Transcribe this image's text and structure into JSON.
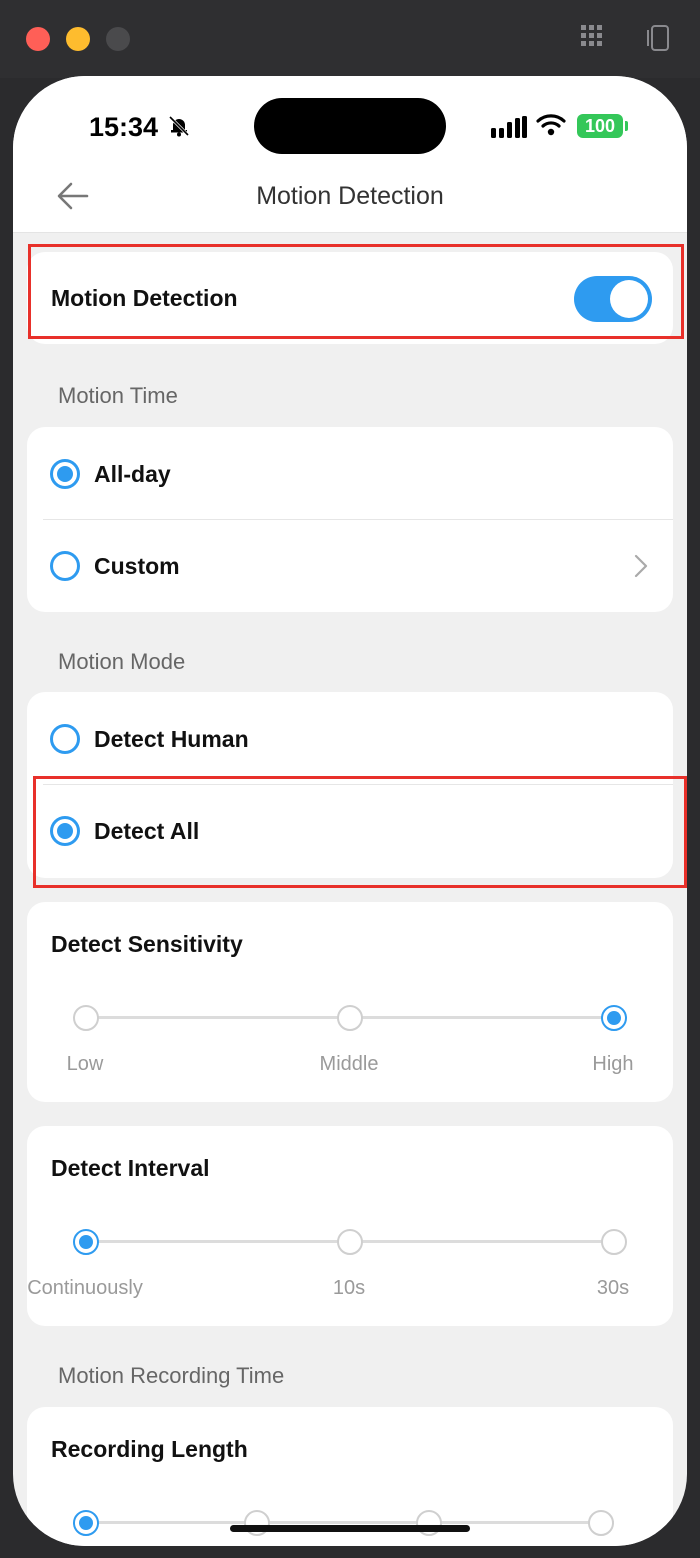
{
  "status": {
    "time": "15:34",
    "battery": "100"
  },
  "nav": {
    "title": "Motion Detection"
  },
  "motion_detection": {
    "label": "Motion Detection",
    "enabled": true
  },
  "motion_time": {
    "section_label": "Motion Time",
    "options": [
      {
        "label": "All-day",
        "selected": true
      },
      {
        "label": "Custom",
        "selected": false
      }
    ]
  },
  "motion_mode": {
    "section_label": "Motion Mode",
    "options": [
      {
        "label": "Detect Human",
        "selected": false
      },
      {
        "label": "Detect All",
        "selected": true
      }
    ]
  },
  "sensitivity": {
    "title": "Detect Sensitivity",
    "levels": [
      "Low",
      "Middle",
      "High"
    ],
    "selected": "High"
  },
  "interval": {
    "title": "Detect Interval",
    "levels": [
      "Continuously",
      "10s",
      "30s"
    ],
    "selected": "Continuously"
  },
  "recording": {
    "section_label": "Motion Recording Time",
    "title": "Recording Length",
    "selected_index": 0,
    "stop_count": 4
  },
  "colors": {
    "accent": "#2e9bf0",
    "highlight": "#e8302a",
    "background": "#f0f0f0"
  },
  "icons": [
    "back-arrow-icon",
    "bell-slash-icon",
    "signal-icon",
    "wifi-icon",
    "chevron-right-icon",
    "grid-icon",
    "rotate-device-icon"
  ]
}
